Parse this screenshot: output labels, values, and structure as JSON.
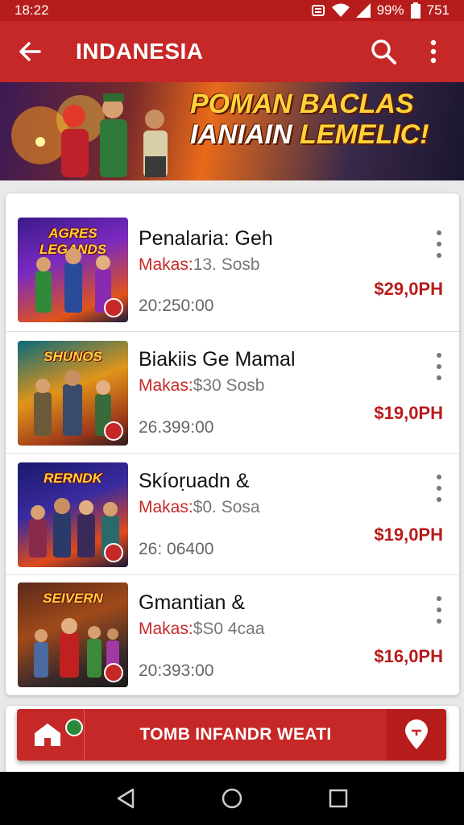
{
  "status": {
    "time": "18:22",
    "battery": "99%",
    "extra": "751"
  },
  "app_bar": {
    "title": "INDANESIA"
  },
  "banner": {
    "line1": "POMAN BACLAS",
    "line2_white": "IANIAIN",
    "line2_yellow": "LEMELIC!"
  },
  "items": [
    {
      "thumb_title": "AGRES LEGANDS",
      "name": "Penalaria: Geh",
      "meta_label": "Makas:",
      "meta_value": "13. Sosb",
      "date": "20:250:00",
      "price": "$29,0PH"
    },
    {
      "thumb_title": "SHUNOS",
      "name": "Biakiis Ge Mamal",
      "meta_label": "Makas:",
      "meta_value": "$30 Sosb",
      "date": "26.399:00",
      "price": "$19,0PH"
    },
    {
      "thumb_title": "RERNDK",
      "name": "Skíoṛuadn &",
      "meta_label": "Makas:",
      "meta_value": "$0. Sosa",
      "date": "26: 06400",
      "price": "$19,0PH"
    },
    {
      "thumb_title": "SEIVERN",
      "name": "Gmantian &",
      "meta_label": "Makas:",
      "meta_value": "$S0 4caa",
      "date": "20:393:00",
      "price": "$16,0PH"
    }
  ],
  "cta": {
    "label": "TOMB INFANDR WEATI"
  },
  "colors": {
    "primary": "#c62828",
    "primary_dark": "#b71c1c",
    "price": "#b71c1c",
    "accent_yellow": "#ffd23a"
  }
}
